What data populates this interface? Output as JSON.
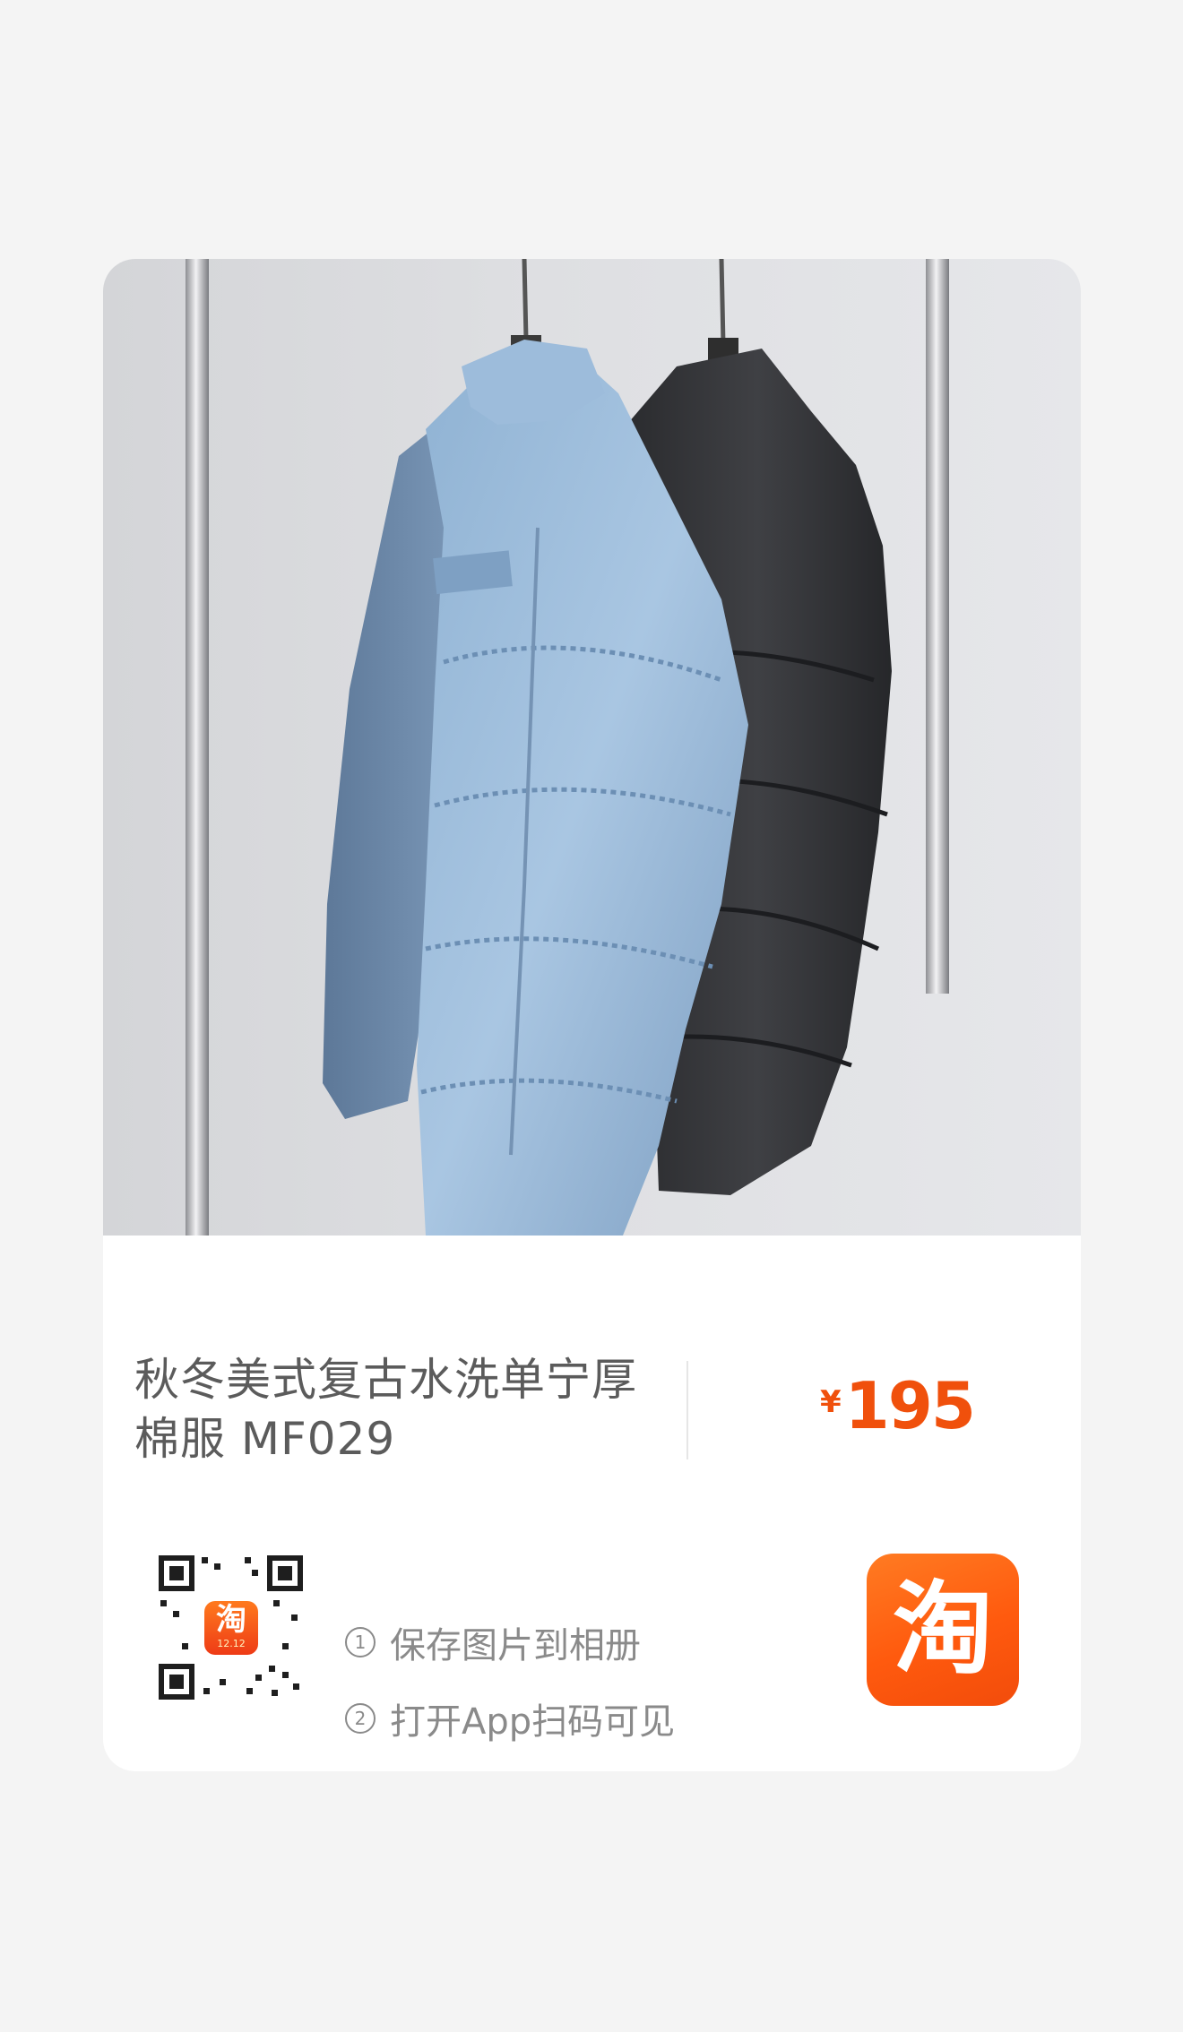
{
  "product": {
    "title": "秋冬美式复古水洗单宁厚棉服 MF029",
    "currency": "¥",
    "price": "195",
    "image_description_icon": "jacket-photo"
  },
  "share": {
    "step1_num": "1",
    "step1": "保存图片到相册",
    "step2_num": "2",
    "step2": "打开App扫码可见"
  },
  "qr": {
    "badge_glyph": "淘",
    "badge_sub": "12.12"
  },
  "brand": {
    "logo_glyph": "淘",
    "accent_color": "#ff5a0e",
    "price_color": "#f0500c"
  }
}
